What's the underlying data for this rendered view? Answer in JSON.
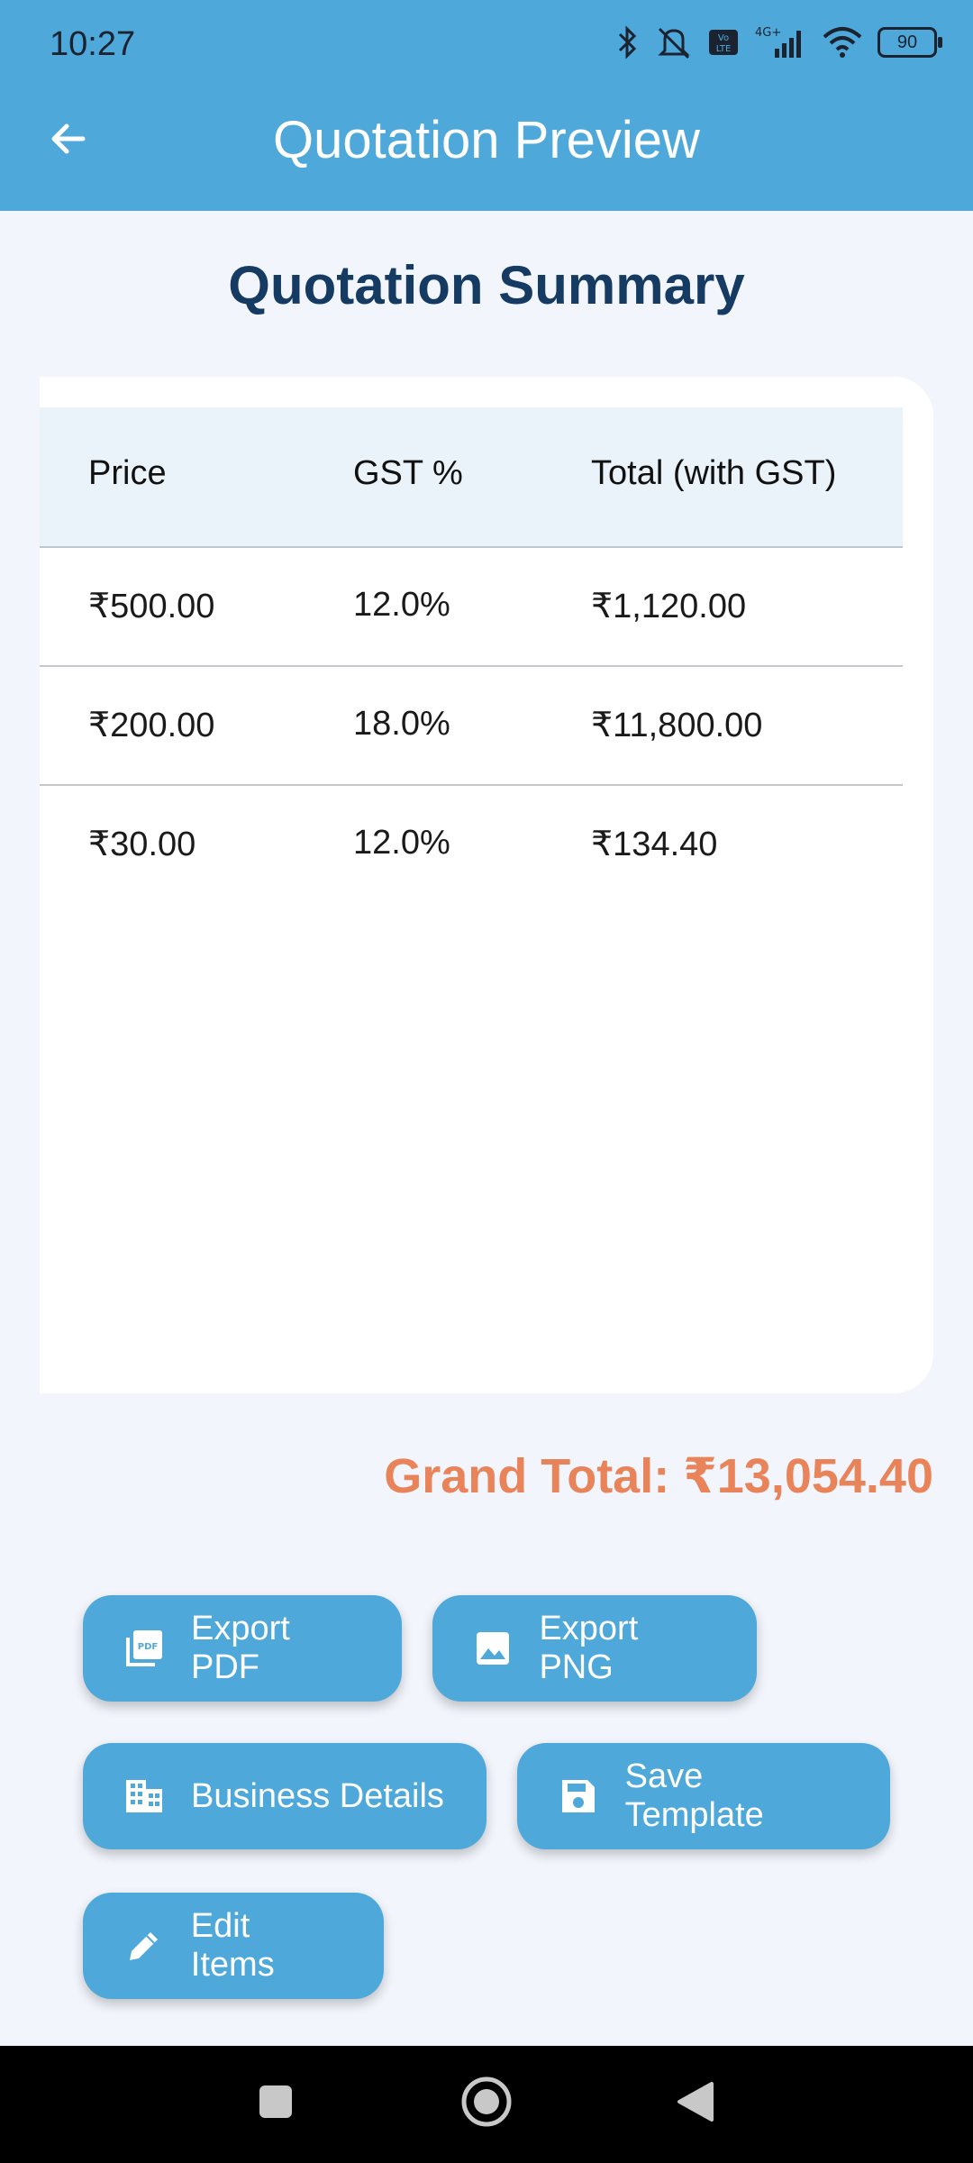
{
  "status_bar": {
    "time": "10:27",
    "battery": "90",
    "network": "4G+"
  },
  "header": {
    "title": "Quotation Preview"
  },
  "summary": {
    "title": "Quotation Summary"
  },
  "table": {
    "headers": [
      "Price",
      "GST %",
      "Total (with GST)"
    ],
    "rows": [
      {
        "price": "₹500.00",
        "gst": "12.0%",
        "total": "₹1,120.00"
      },
      {
        "price": "₹200.00",
        "gst": "18.0%",
        "total": "₹11,800.00"
      },
      {
        "price": "₹30.00",
        "gst": "12.0%",
        "total": "₹134.40"
      }
    ]
  },
  "grand_total": "Grand Total: ₹13,054.40",
  "actions": {
    "export_pdf": "Export PDF",
    "export_png": "Export PNG",
    "business_details": "Business Details",
    "save_template": "Save Template",
    "edit_items": "Edit Items"
  },
  "colors": {
    "primary": "#4ea8da",
    "title": "#163b63",
    "accent": "#e9845a",
    "background": "#f2f6fc"
  }
}
